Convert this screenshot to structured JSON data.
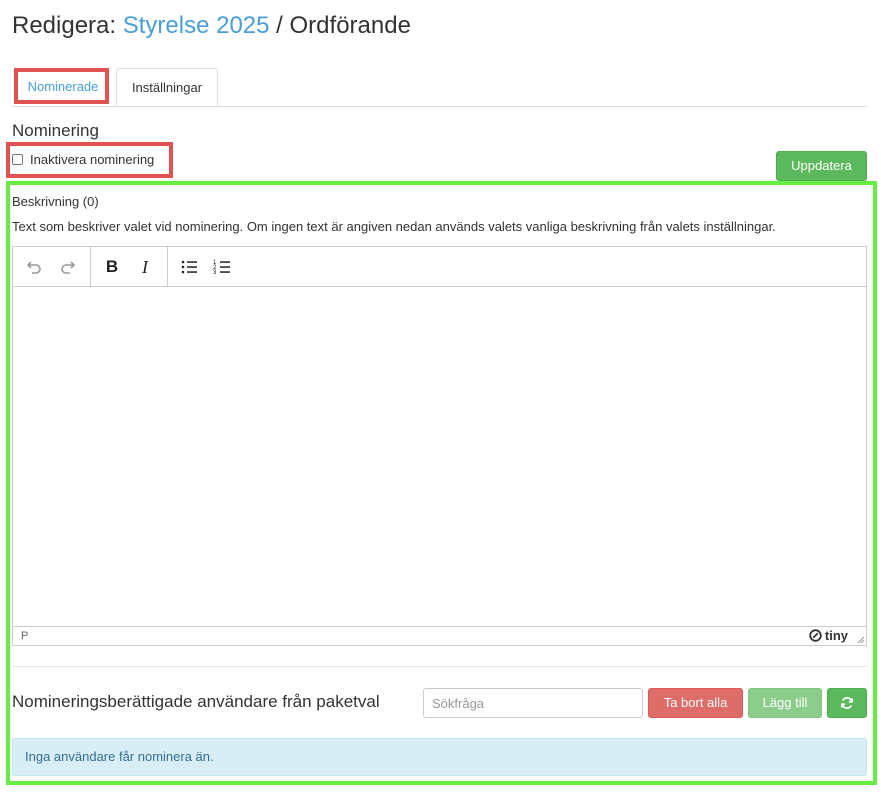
{
  "header": {
    "prefix": "Redigera:",
    "election_link": "Styrelse 2025",
    "separator": "/",
    "position": "Ordförande"
  },
  "tabs": [
    {
      "label": "Nominerade",
      "active": false
    },
    {
      "label": "Inställningar",
      "active": true
    }
  ],
  "nomination": {
    "section_title": "Nominering",
    "disable_checkbox_label": "Inaktivera nominering",
    "disable_checked": false,
    "update_button": "Uppdatera"
  },
  "description": {
    "label": "Beskrivning (0)",
    "help_text": "Text som beskriver valet vid nominering. Om ingen text är angiven nedan används valets vanliga beskrivning från valets inställningar.",
    "editor": {
      "toolbar": [
        "undo-icon",
        "redo-icon",
        "bold-icon",
        "italic-icon",
        "bullet-list-icon",
        "numbered-list-icon"
      ],
      "bold_label": "B",
      "italic_label": "I",
      "status_path": "P",
      "brand": "tiny",
      "content": ""
    }
  },
  "eligible_users": {
    "title": "Nomineringsberättigade användare från paketval",
    "search_placeholder": "Sökfråga",
    "remove_all_button": "Ta bort alla",
    "add_button": "Lägg till",
    "refresh_icon": "refresh-icon",
    "empty_message": "Inga användare får nominera än."
  },
  "colors": {
    "link": "#4a9fd8",
    "success": "#5cb85c",
    "danger": "#d9534f",
    "info_bg": "#d9edf7",
    "info_text": "#31708f",
    "highlight_red": "#e05353",
    "highlight_green": "#66ee44"
  }
}
